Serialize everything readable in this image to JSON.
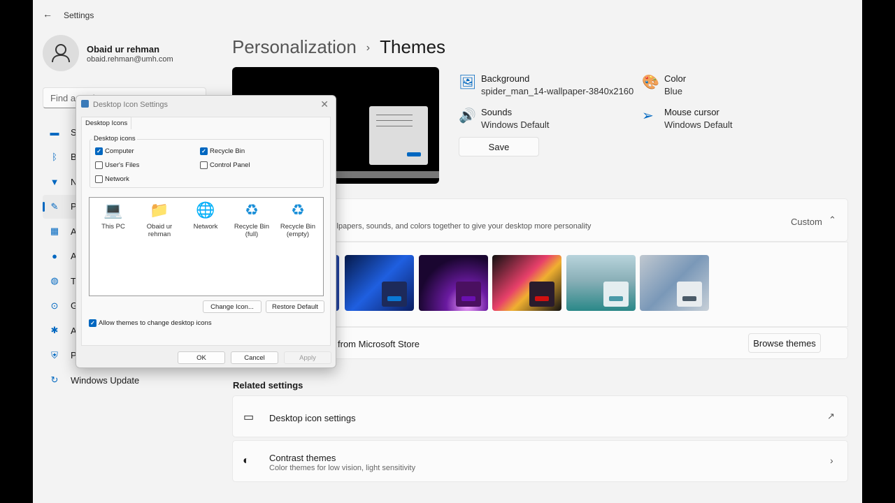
{
  "app": {
    "title": "Settings",
    "back_icon": "back-arrow-icon"
  },
  "user": {
    "name": "Obaid ur rehman",
    "email": "obaid.rehman@umh.com"
  },
  "search": {
    "placeholder": "Find a setting"
  },
  "sidebar": {
    "items": [
      {
        "label": "System",
        "icon": "monitor-icon"
      },
      {
        "label": "Bluetooth & devices",
        "icon": "bluetooth-icon"
      },
      {
        "label": "Network & internet",
        "icon": "wifi-icon"
      },
      {
        "label": "Personalization",
        "icon": "brush-icon",
        "selected": true
      },
      {
        "label": "Apps",
        "icon": "apps-icon"
      },
      {
        "label": "Accounts",
        "icon": "person-icon"
      },
      {
        "label": "Time & language",
        "icon": "globe-icon"
      },
      {
        "label": "Gaming",
        "icon": "gamepad-icon"
      },
      {
        "label": "Accessibility",
        "icon": "accessibility-icon"
      },
      {
        "label": "Privacy & security",
        "icon": "shield-icon"
      },
      {
        "label": "Windows Update",
        "icon": "update-icon"
      }
    ]
  },
  "header": {
    "parent": "Personalization",
    "separator": "›",
    "title": "Themes"
  },
  "props": {
    "background": {
      "label": "Background",
      "value": "spider_man_14-wallpaper-3840x2160"
    },
    "color": {
      "label": "Color",
      "value": "Blue"
    },
    "sounds": {
      "label": "Sounds",
      "value": "Windows Default"
    },
    "cursor": {
      "label": "Mouse cursor",
      "value": "Windows Default"
    },
    "save": "Save"
  },
  "current_theme": {
    "description": "allpapers, sounds, and colors together to give your desktop more personality",
    "value": "Custom"
  },
  "themes": [
    {
      "bg": "linear-gradient(135deg,#061a4a,#1f5fe0 50%,#0b1d60)",
      "mini": "#1d2a5a",
      "accent": "#0a78d4"
    },
    {
      "bg": "radial-gradient(circle at 70% 90%,#f0a0ff,#6a1aa0 30%,#1a0630 70%)",
      "mini": "#4a1060",
      "accent": "#6a10b0"
    },
    {
      "bg": "linear-gradient(135deg,#111,#e8406a 45%,#f0b030 60%,#111)",
      "mini": "#2a1c2c",
      "accent": "#d01010"
    },
    {
      "bg": "linear-gradient(180deg,#b8d4dc,#8ab0b8 45%,#2a8888)",
      "mini": "#e4eef0",
      "accent": "#4a9aa8"
    },
    {
      "bg": "linear-gradient(135deg,#c0c8d0,#7a98b8 50%,#c8d0d8)",
      "mini": "#e8ecef",
      "accent": "#4a5a68"
    }
  ],
  "store": {
    "text": "from Microsoft Store",
    "button": "Browse themes"
  },
  "related": {
    "heading": "Related settings",
    "desktop_icons": {
      "label": "Desktop icon settings"
    },
    "contrast": {
      "label": "Contrast themes",
      "sub": "Color themes for low vision, light sensitivity"
    }
  },
  "dialog": {
    "title": "Desktop Icon Settings",
    "tab": "Desktop Icons",
    "group": "Desktop icons",
    "checks": [
      {
        "label": "Computer",
        "checked": true
      },
      {
        "label": "Recycle Bin",
        "checked": true
      },
      {
        "label": "User's Files",
        "checked": false
      },
      {
        "label": "Control Panel",
        "checked": false
      },
      {
        "label": "Network",
        "checked": false
      }
    ],
    "icons": [
      {
        "l1": "This PC",
        "l2": ""
      },
      {
        "l1": "Obaid ur",
        "l2": "rehman"
      },
      {
        "l1": "Network",
        "l2": ""
      },
      {
        "l1": "Recycle Bin",
        "l2": "(full)"
      },
      {
        "l1": "Recycle Bin",
        "l2": "(empty)"
      }
    ],
    "change_icon": "Change Icon...",
    "restore": "Restore Default",
    "allow": "Allow themes to change desktop icons",
    "allow_checked": true,
    "ok": "OK",
    "cancel": "Cancel",
    "apply": "Apply"
  },
  "colors": {
    "accent": "#0067c0"
  }
}
